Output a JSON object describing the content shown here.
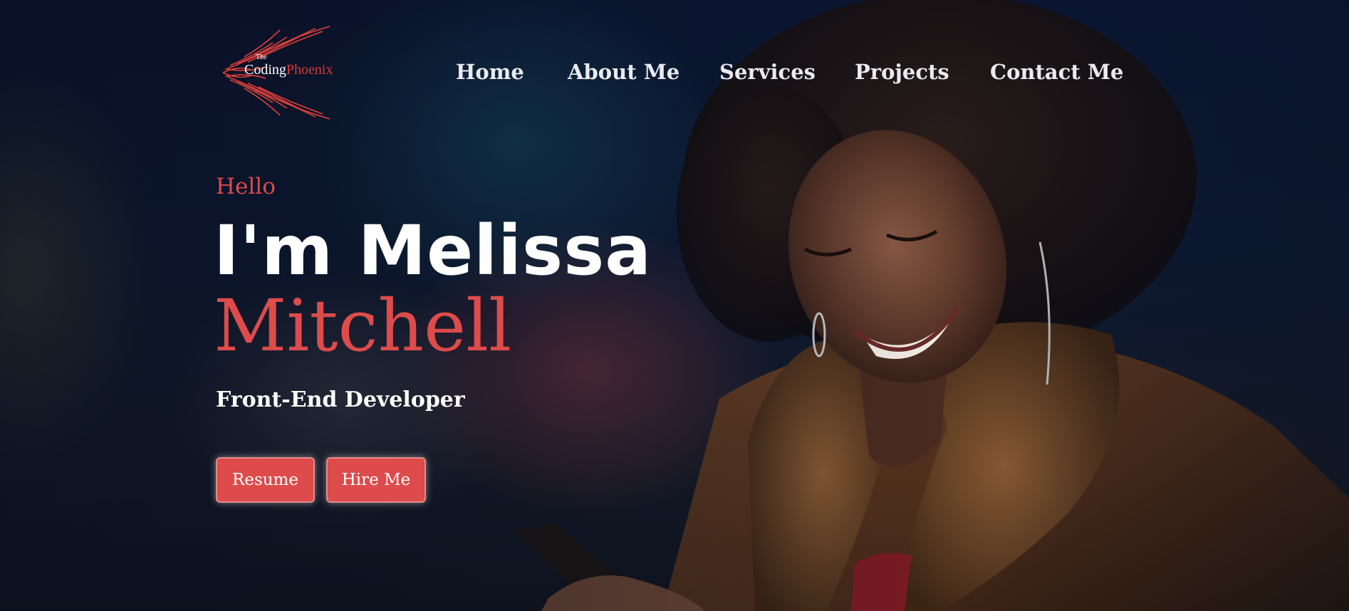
{
  "header": {
    "logo": {
      "the_text": "The",
      "coding_text": "Coding",
      "phoenix_text": "Phoenix"
    },
    "nav": [
      {
        "label": "Home"
      },
      {
        "label": "About Me"
      },
      {
        "label": "Services"
      },
      {
        "label": "Projects"
      },
      {
        "label": "Contact Me"
      }
    ]
  },
  "hero": {
    "greeting": "Hello",
    "name_line1": "I'm Melissa",
    "name_line2": "Mitchell",
    "role": "Front-End Developer",
    "buttons": {
      "resume_label": "Resume",
      "hire_label": "Hire Me"
    }
  },
  "colors": {
    "accent": "#dd4b4b",
    "background": "#0b1733",
    "text": "#ffffff"
  }
}
